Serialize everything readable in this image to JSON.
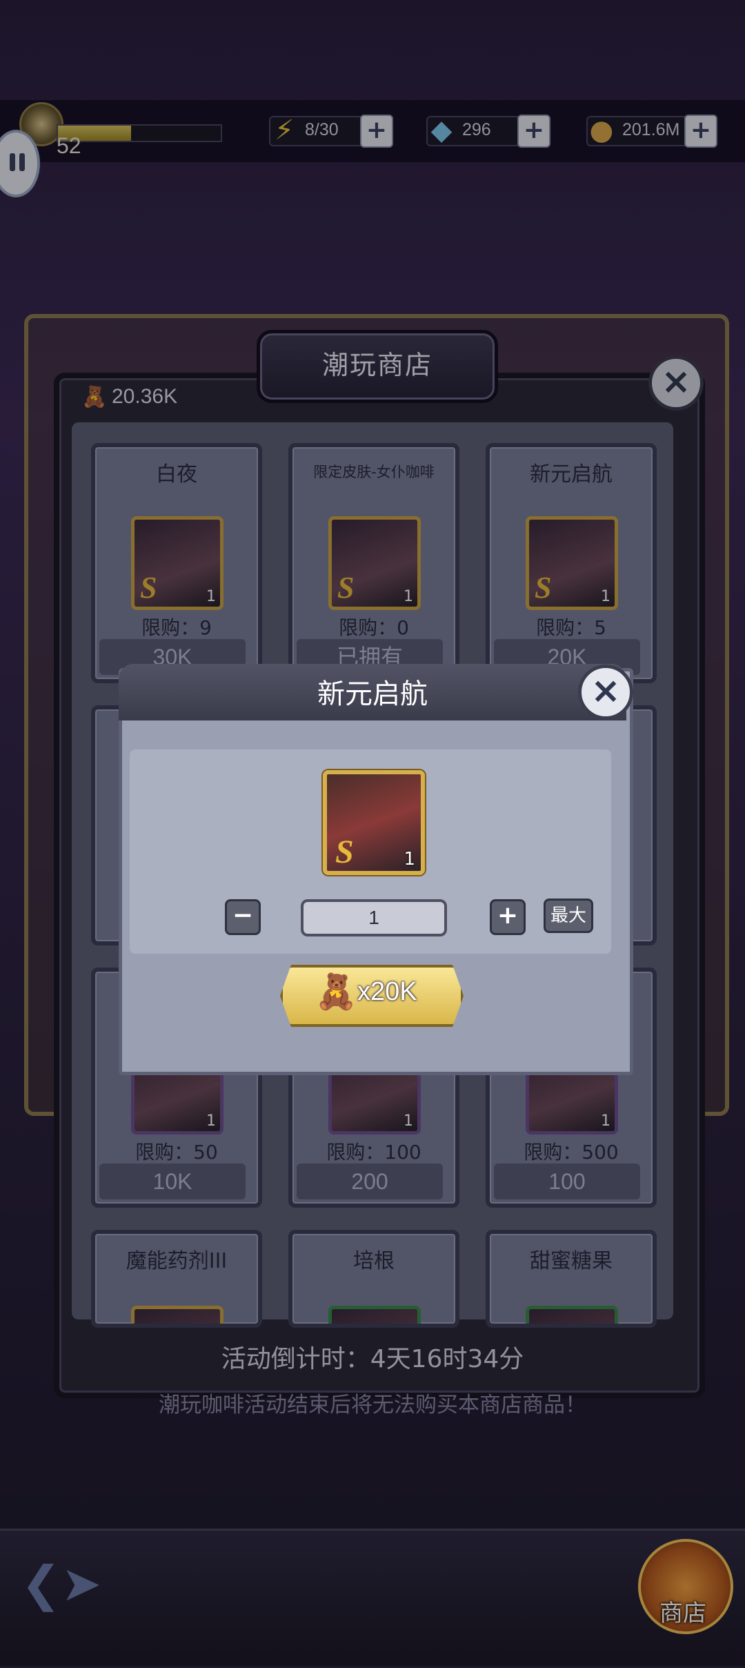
{
  "top_bar": {
    "level": "52",
    "xp_fraction": 0.45,
    "energy": "8/30",
    "gems": "296",
    "gold": "201.6M"
  },
  "shop": {
    "title": "潮玩商店",
    "currency_balance": "20.36K",
    "items": [
      {
        "name": "白夜",
        "limit": "限购：9",
        "price": "30K",
        "qty": "1",
        "rank": "S"
      },
      {
        "name": "限定皮肤-女仆咖啡",
        "limit": "限购：0",
        "price": "已拥有",
        "qty": "1",
        "rank": "S"
      },
      {
        "name": "新元启航",
        "limit": "限购：5",
        "price": "20K",
        "qty": "1",
        "rank": "S"
      },
      {
        "name": "",
        "limit": "限购：50",
        "price": "10K",
        "qty": "1"
      },
      {
        "name": "",
        "limit": "限购：100",
        "price": "200",
        "qty": "1"
      },
      {
        "name": "",
        "limit": "限购：500",
        "price": "100",
        "qty": "1"
      },
      {
        "name": "魔能药剂III",
        "limit": "",
        "price": ""
      },
      {
        "name": "培根",
        "limit": "",
        "price": ""
      },
      {
        "name": "甜蜜糖果",
        "limit": "",
        "price": ""
      }
    ],
    "countdown": "活动倒计时：4天16时34分",
    "notice": "潮玩咖啡活动结束后将无法购买本商店商品！"
  },
  "modal": {
    "title": "新元启航",
    "item_qty": "1",
    "item_rank": "S",
    "minus_label": "−",
    "plus_label": "+",
    "quantity": "1",
    "max_label": "最大",
    "price_label": "x20K"
  },
  "bottom_nav": {
    "shop_label": "商店"
  },
  "icons": {
    "energy": "lightning-icon",
    "gems": "diamond-icon",
    "gold": "coin-icon",
    "currency": "bear-token-icon"
  }
}
